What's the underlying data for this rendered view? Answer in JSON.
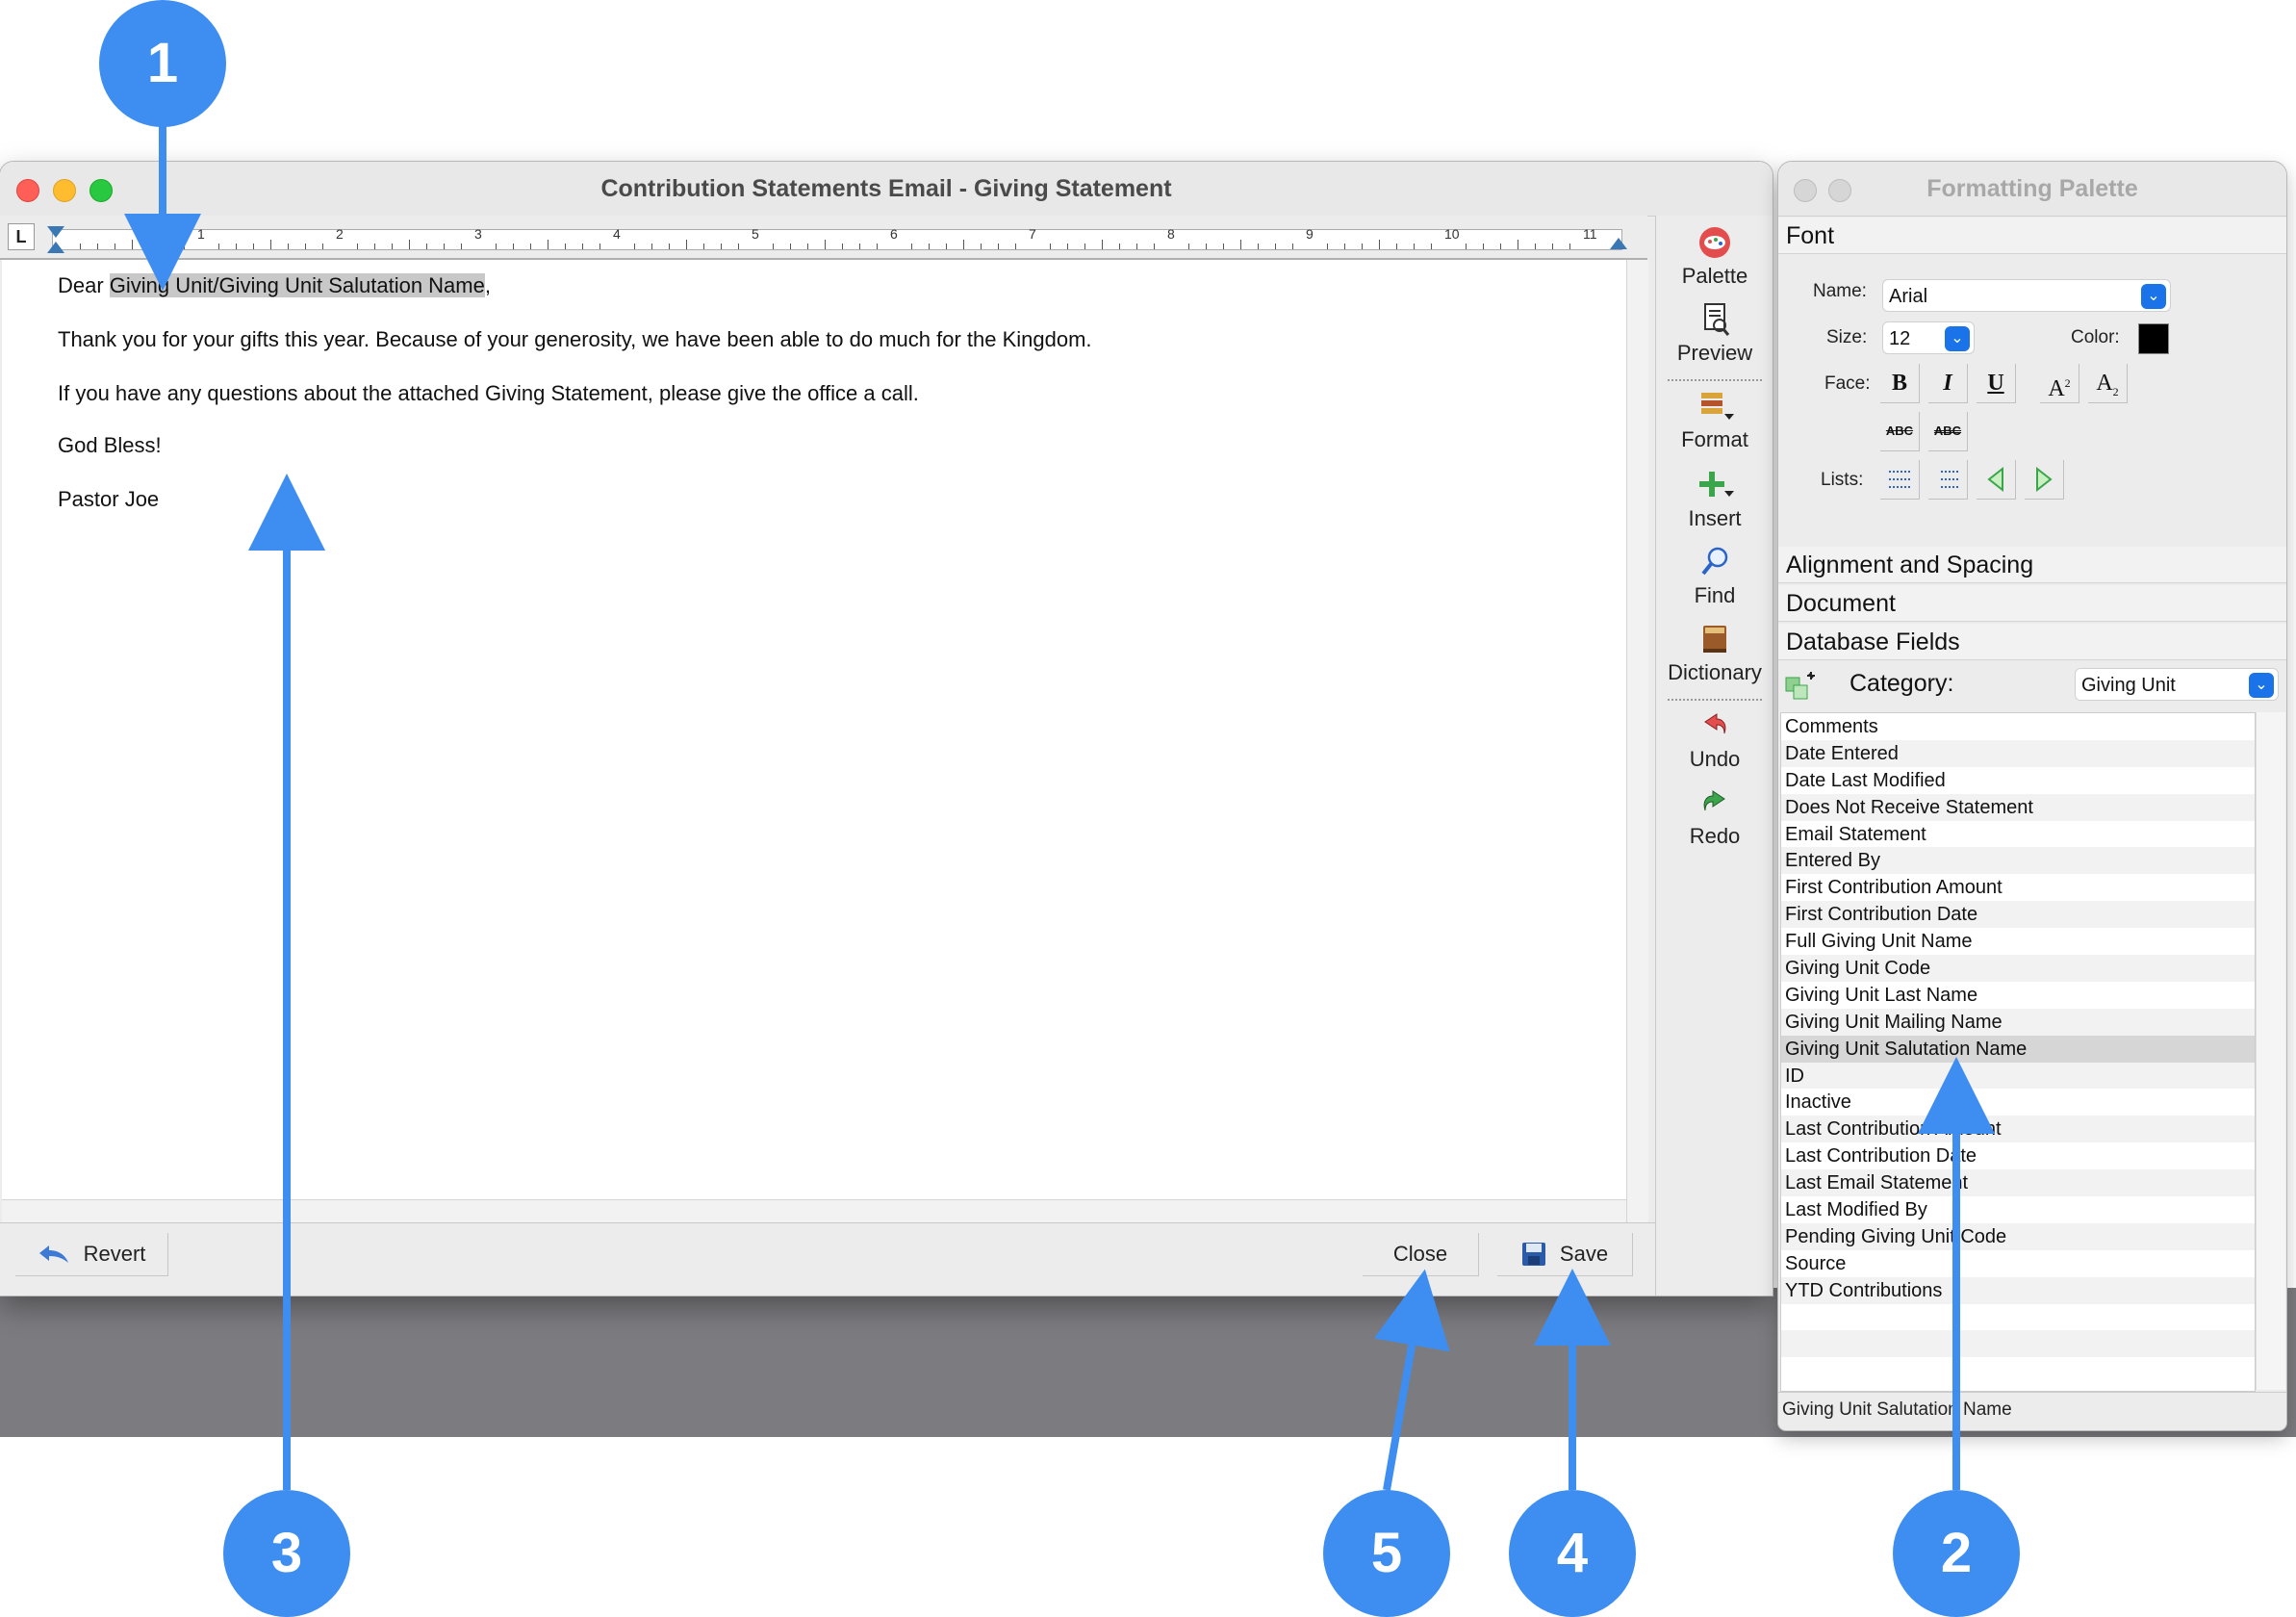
{
  "window": {
    "title": "Contribution Statements Email - Giving Statement",
    "tab_stop": "L",
    "ruler_numbers": [
      "1",
      "2",
      "3",
      "4",
      "5",
      "6",
      "7",
      "8",
      "9",
      "10",
      "11"
    ]
  },
  "document": {
    "greeting_prefix": "Dear ",
    "merge_field": "Giving Unit/Giving Unit Salutation Name",
    "greeting_suffix": ",",
    "line2": "Thank you for your gifts this year. Because of your generosity,  we have been able to do much for the Kingdom.",
    "line3": "If you have any questions about the attached Giving Statement, please give the office a call.",
    "line4": "God Bless!",
    "line5": "Pastor Joe"
  },
  "bottombar": {
    "revert": "Revert",
    "close": "Close",
    "save": "Save"
  },
  "toolbar": {
    "palette": "Palette",
    "preview": "Preview",
    "format": "Format",
    "insert": "Insert",
    "find": "Find",
    "dictionary": "Dictionary",
    "undo": "Undo",
    "redo": "Redo"
  },
  "palette": {
    "title": "Formatting Palette",
    "font_section": "Font",
    "name_label": "Name:",
    "name_value": "Arial",
    "size_label": "Size:",
    "size_value": "12",
    "color_label": "Color:",
    "color_value": "#000000",
    "face_label": "Face:",
    "lists_label": "Lists:",
    "alignment_section": "Alignment and Spacing",
    "document_section": "Document",
    "database_section": "Database Fields",
    "category_label": "Category:",
    "category_value": "Giving Unit",
    "fields": [
      "Comments",
      "Date Entered",
      "Date Last Modified",
      "Does Not Receive Statement",
      "Email Statement",
      "Entered By",
      "First Contribution Amount",
      "First Contribution Date",
      "Full Giving Unit Name",
      "Giving Unit Code",
      "Giving Unit Last Name",
      "Giving Unit Mailing Name",
      "Giving Unit Salutation Name",
      "ID",
      "Inactive",
      "Last Contribution Amount",
      "Last Contribution Date",
      "Last Email Statement",
      "Last Modified By",
      "Pending Giving Unit Code",
      "Source",
      "YTD Contributions"
    ],
    "selected_field": "Giving Unit Salutation Name",
    "status": "Giving Unit Salutation Name"
  },
  "callouts": [
    "1",
    "2",
    "3",
    "4",
    "5"
  ],
  "colors": {
    "callout": "#3d8ef0",
    "selection": "#c8c8c8"
  }
}
